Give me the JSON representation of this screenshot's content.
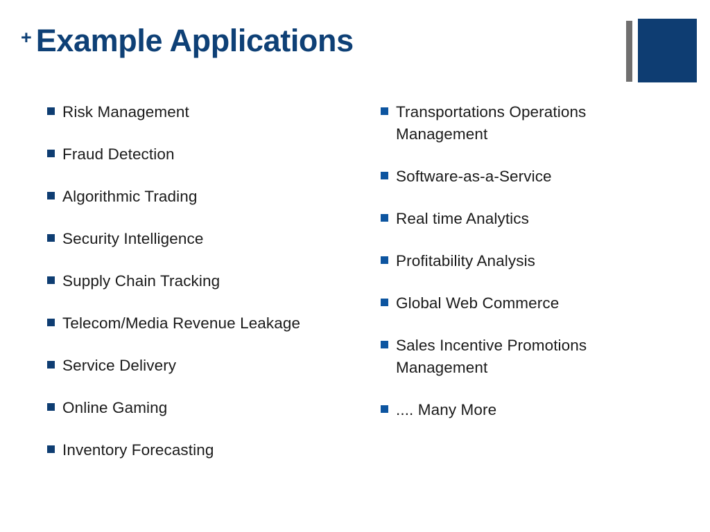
{
  "slide": {
    "title_prefix": "+",
    "title": "Example Applications",
    "background_color": "#ffffff",
    "accent_navy": "#0e3d72",
    "accent_blue": "#0d55a0",
    "title_color": "#0e4076",
    "decoration_gray": "#706f6f"
  },
  "columns": {
    "left": {
      "items": [
        {
          "label": "Risk Management"
        },
        {
          "label": "Fraud Detection"
        },
        {
          "label": "Algorithmic Trading"
        },
        {
          "label": "Security Intelligence"
        },
        {
          "label": "Supply Chain Tracking"
        },
        {
          "label": "Telecom/Media Revenue Leakage"
        },
        {
          "label": "Service Delivery"
        },
        {
          "label": "Online Gaming"
        },
        {
          "label": "Inventory Forecasting"
        }
      ]
    },
    "right": {
      "items": [
        {
          "label": "Transportations Operations Management"
        },
        {
          "label": "Software-as-a-Service"
        },
        {
          "label": "Real time Analytics"
        },
        {
          "label": "Profitability Analysis"
        },
        {
          "label": "Global Web Commerce"
        },
        {
          "label": "Sales Incentive Promotions Management"
        },
        {
          "label": ".... Many More"
        }
      ]
    }
  }
}
